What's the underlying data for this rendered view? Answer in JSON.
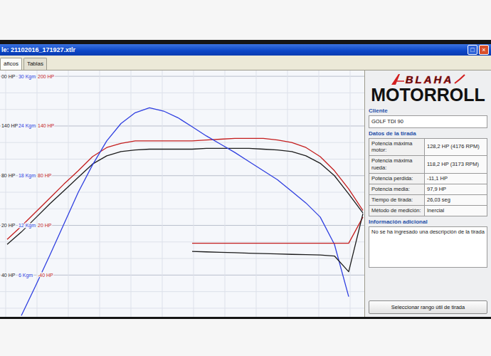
{
  "window": {
    "title": "le: 21102016_171927.xtlr",
    "buttons": [
      "□",
      "×"
    ]
  },
  "tabs": [
    {
      "label": "áficos",
      "selected": true
    },
    {
      "label": "Tablas",
      "selected": false
    }
  ],
  "chart": {
    "y_labels": [
      {
        "value": 200,
        "hp": "00 HP",
        "kgm": "30 Kgm",
        "hp_right": "200 HP"
      },
      {
        "value": 140,
        "hp": "140 HP",
        "kgm": "24 Kgm",
        "hp_right": "140 HP"
      },
      {
        "value": 80,
        "hp": "80 HP",
        "kgm": "18 Kgm",
        "hp_right": "80 HP"
      },
      {
        "value": 20,
        "hp": "20 HP",
        "kgm": "12 Kgm",
        "hp_right": "20 HP"
      },
      {
        "value": -40,
        "hp": "40 HP",
        "kgm": "6 Kgm",
        "hp_right": "-40 HP"
      }
    ],
    "label_colors": {
      "hp": "#1c1c1c",
      "kgm": "#2f3fe0",
      "hp_right": "#c41d1d"
    },
    "series": [
      {
        "kind": "power",
        "color": "#c41d1d",
        "values": [
          3,
          19,
          36,
          53,
          70,
          86,
          103,
          114,
          119,
          122,
          122,
          122,
          122,
          122,
          123,
          124,
          125,
          125,
          125,
          123,
          120,
          114,
          103,
          86,
          64,
          38
        ]
      },
      {
        "kind": "power",
        "color": "#1c1c1c",
        "values": [
          -3,
          12,
          29,
          46,
          62,
          78,
          94,
          104,
          109,
          111,
          112,
          112,
          112,
          112,
          113,
          113,
          113,
          113,
          112,
          111,
          109,
          104,
          95,
          80,
          58,
          35
        ]
      },
      {
        "kind": "torque",
        "color": "#2f3fe0",
        "values": [
          null,
          1.1,
          4.7,
          8.4,
          12.2,
          16.0,
          19.3,
          22.2,
          24.3,
          25.6,
          26.2,
          25.8,
          25.0,
          23.9,
          22.8,
          21.8,
          20.8,
          19.7,
          18.6,
          17.5,
          16.1,
          14.7,
          13.0,
          9.7,
          3.4,
          null
        ]
      },
      {
        "kind": "power",
        "color": "#c41d1d",
        "values": [
          null,
          null,
          null,
          null,
          null,
          null,
          null,
          null,
          null,
          null,
          null,
          null,
          null,
          -1.5,
          -1.5,
          -1.5,
          -1.5,
          -1.5,
          -1.5,
          -1.5,
          -1.5,
          -1.5,
          -1.5,
          -1.5,
          -1.5,
          30
        ]
      },
      {
        "kind": "power",
        "color": "#1c1c1c",
        "values": [
          null,
          null,
          null,
          null,
          null,
          null,
          null,
          null,
          null,
          null,
          null,
          null,
          null,
          -11.5,
          -12,
          -12.5,
          -13,
          -13.5,
          -14,
          -14.5,
          -15,
          -15.3,
          -15.7,
          -17,
          -36,
          34
        ]
      }
    ]
  },
  "logo": {
    "brand": "BLAHA",
    "name": "MOTORROLL"
  },
  "client": {
    "title": "Cliente",
    "value": "GOLF TDI 90"
  },
  "run": {
    "title": "Datos de la tirada",
    "rows": [
      {
        "label": "Potencia máxima motor:",
        "value": "128,2 HP (4176 RPM)"
      },
      {
        "label": "Potencia máxima rueda:",
        "value": "118,2 HP (3173 RPM)"
      },
      {
        "label": "Potencia perdida:",
        "value": "-11,1 HP"
      },
      {
        "label": "Potencia media:",
        "value": "97,9 HP"
      },
      {
        "label": "Tiempo de tirada:",
        "value": "26,03 seg"
      },
      {
        "label": "Método de medición:",
        "value": "Inercial"
      }
    ]
  },
  "info": {
    "title": "Información adicional",
    "text": "No se ha ingresado una descripción de la tirada"
  },
  "button": "Seleccionar rango útil de tirada"
}
